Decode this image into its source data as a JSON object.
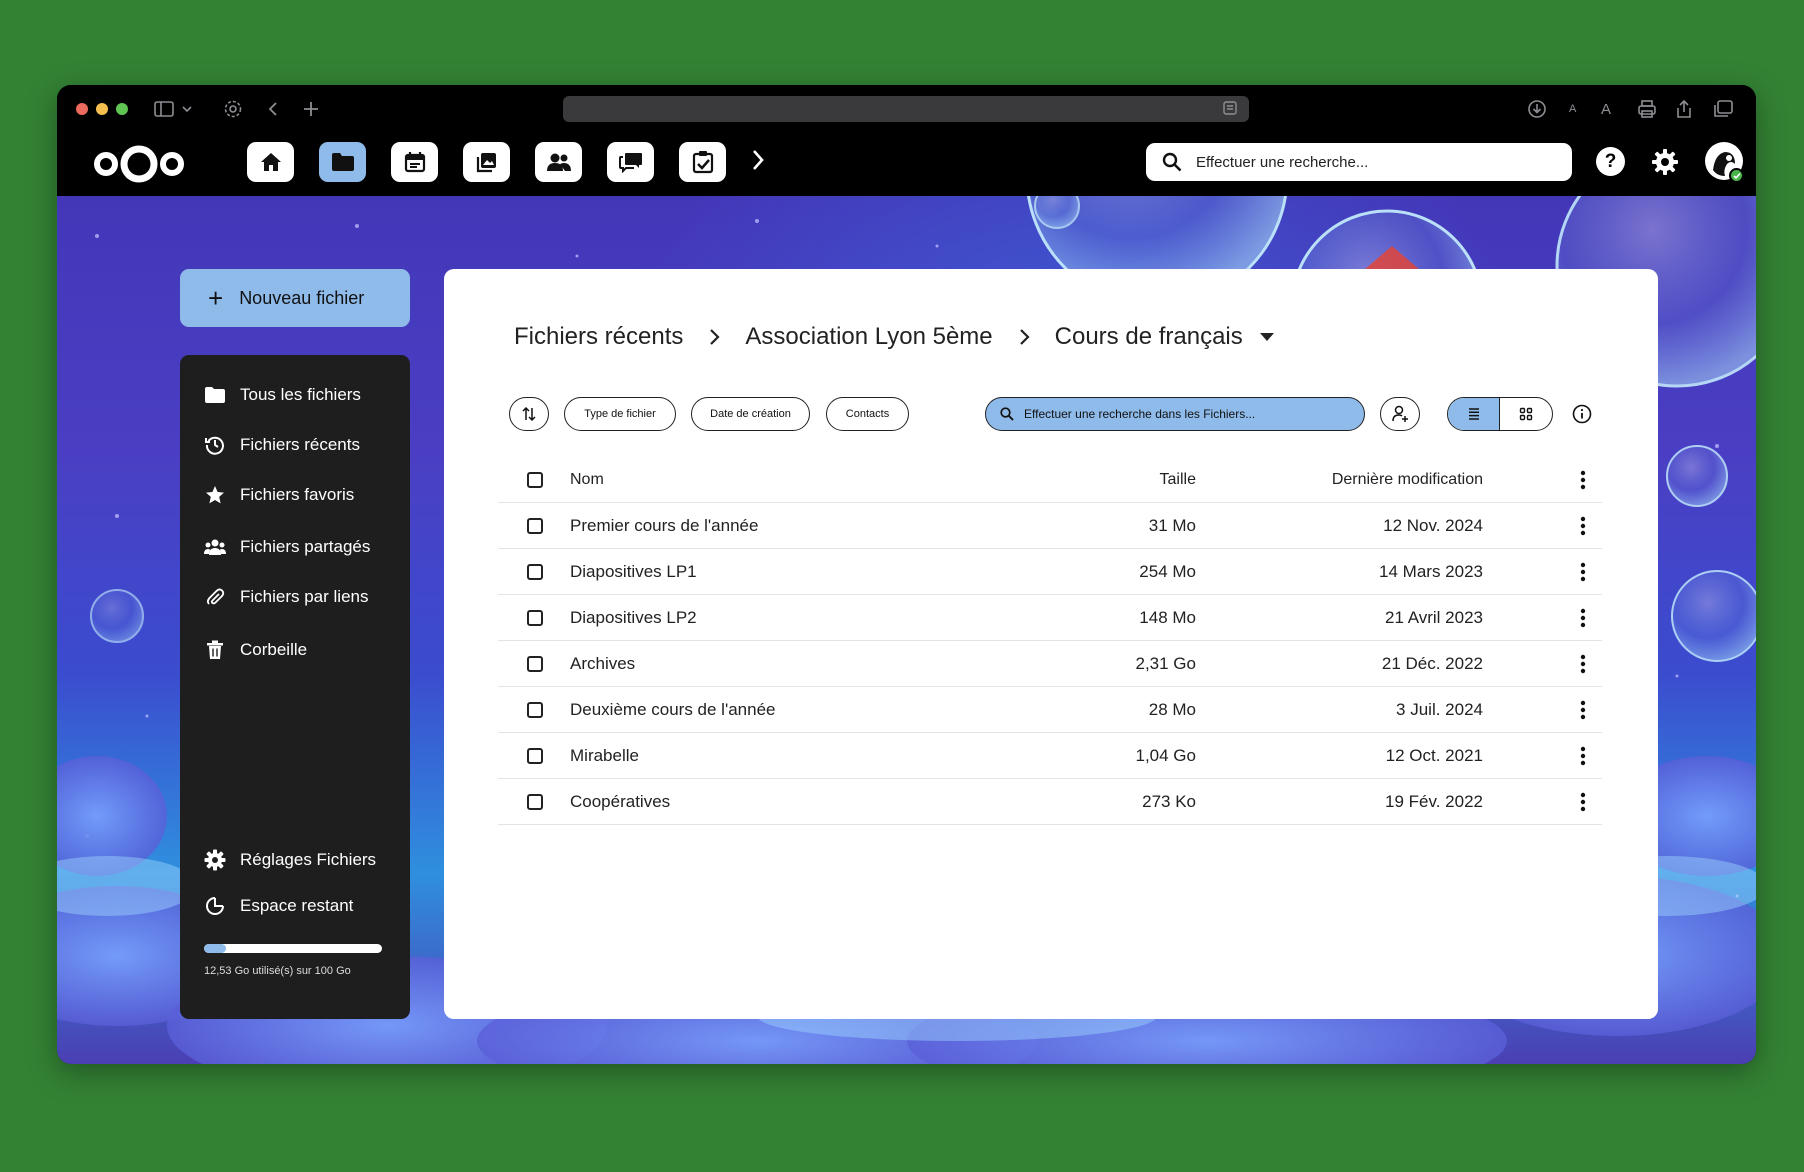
{
  "browser": {
    "url": ""
  },
  "header": {
    "apps": [
      {
        "name": "home-icon",
        "active": false
      },
      {
        "name": "folder-icon",
        "active": true
      },
      {
        "name": "calendar-icon",
        "active": false
      },
      {
        "name": "photos-icon",
        "active": false
      },
      {
        "name": "contacts-icon",
        "active": false
      },
      {
        "name": "chat-icon",
        "active": false
      },
      {
        "name": "tasks-icon",
        "active": false
      }
    ],
    "search_placeholder": "Effectuer une recherche...",
    "help_label": "?"
  },
  "sidebar": {
    "new_file_label": "Nouveau fichier",
    "items": [
      {
        "label": "Tous les fichiers",
        "icon": "folder-icon"
      },
      {
        "label": "Fichiers récents",
        "icon": "history-icon"
      },
      {
        "label": "Fichiers favoris",
        "icon": "star-icon"
      },
      {
        "label": "Fichiers partagés",
        "icon": "shared-icon"
      },
      {
        "label": "Fichiers par liens",
        "icon": "paperclip-icon"
      },
      {
        "label": "Corbeille",
        "icon": "trash-icon"
      }
    ],
    "settings_label": "Réglages Fichiers",
    "space_label": "Espace restant",
    "quota_text": "12,53 Go utilisé(s) sur 100 Go",
    "quota_fraction": 0.1253
  },
  "main": {
    "breadcrumb": [
      "Fichiers récents",
      "Association Lyon 5ème",
      "Cours de français"
    ],
    "filters": {
      "type": "Type de fichier",
      "date": "Date de création",
      "contacts": "Contacts"
    },
    "search_placeholder": "Effectuer une recherche dans les Fichiers...",
    "table": {
      "headers": {
        "name": "Nom",
        "size": "Taille",
        "modified": "Dernière modification"
      },
      "rows": [
        {
          "name": "Premier cours de l'année",
          "size": "31 Mo",
          "modified": "12 Nov. 2024"
        },
        {
          "name": "Diapositives LP1",
          "size": "254 Mo",
          "modified": "14 Mars 2023"
        },
        {
          "name": "Diapositives LP2",
          "size": "148 Mo",
          "modified": "21 Avril 2023"
        },
        {
          "name": "Archives",
          "size": "2,31 Go",
          "modified": "21 Déc. 2022"
        },
        {
          "name": "Deuxième cours de l'année",
          "size": "28 Mo",
          "modified": "3 Juil. 2024"
        },
        {
          "name": "Mirabelle",
          "size": "1,04 Go",
          "modified": "12 Oct. 2021"
        },
        {
          "name": "Coopératives",
          "size": "273 Ko",
          "modified": "19 Fév. 2022"
        }
      ]
    }
  },
  "colors": {
    "accent": "#8fbbea",
    "page_bg": "#338234",
    "sidebar_bg": "#1e1e1e"
  }
}
